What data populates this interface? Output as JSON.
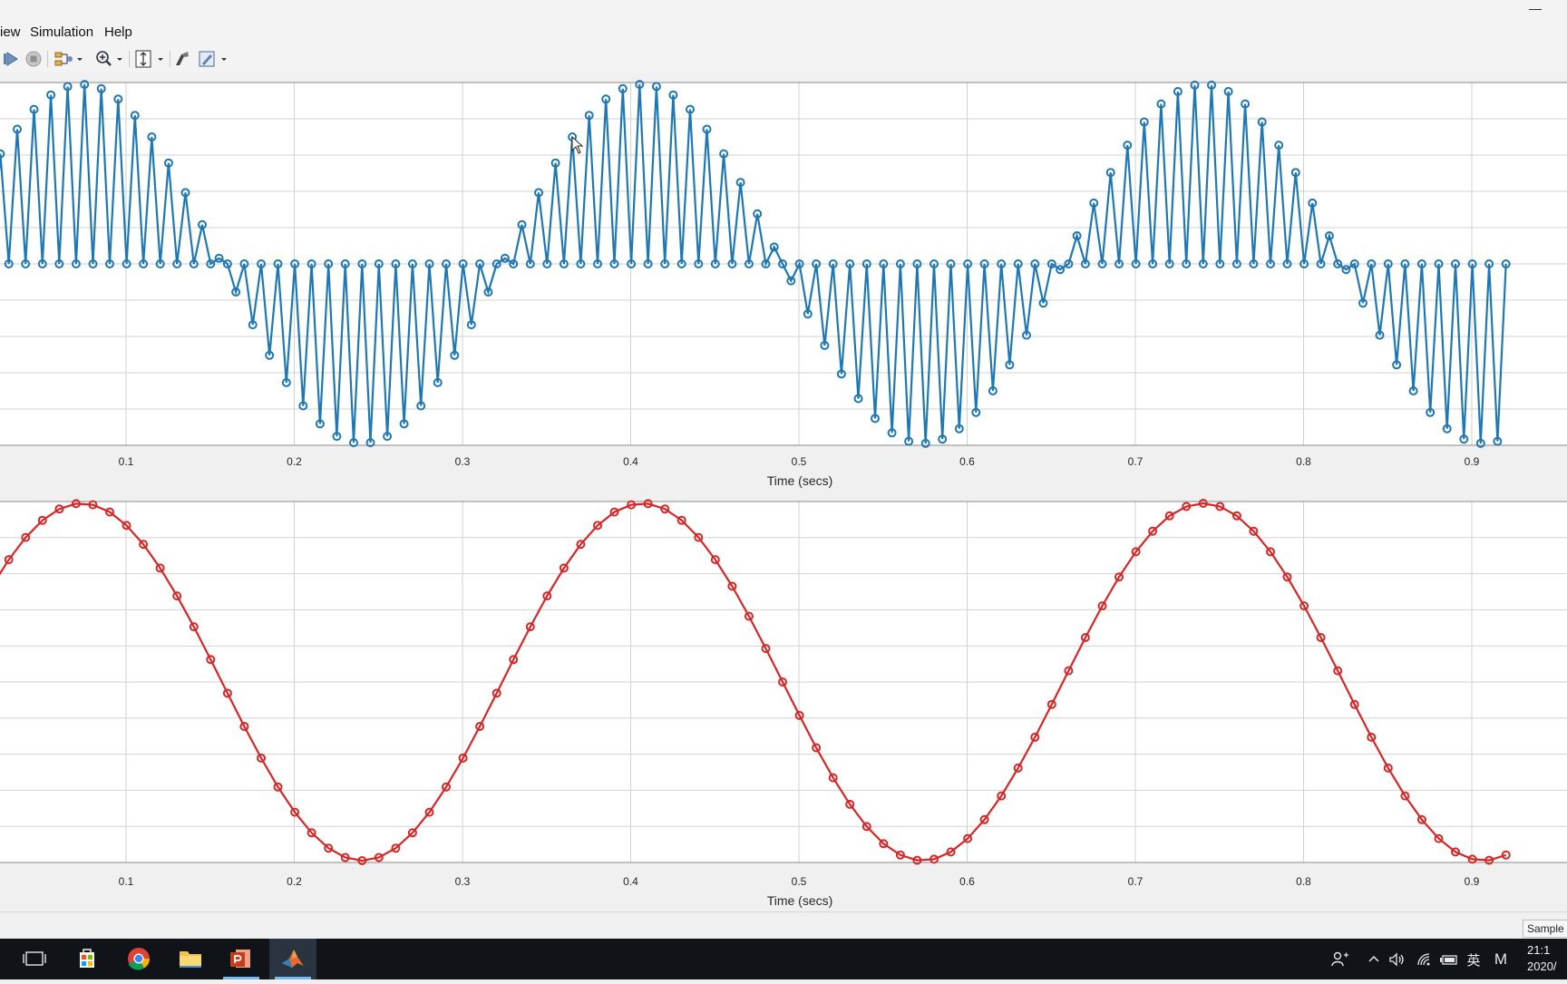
{
  "window": {
    "minimize_glyph": "—"
  },
  "menu": {
    "items": [
      "iew",
      "Simulation",
      "Help"
    ]
  },
  "toolbar": {
    "icons": [
      "run-icon",
      "stop-icon",
      "signal-selector-icon",
      "zoom-icon",
      "scale-axes-icon",
      "style-icon",
      "properties-icon"
    ]
  },
  "colors": {
    "top_series": "#1f77b4",
    "bottom_series": "#d62728",
    "axes_bg": "#ffffff",
    "grid": "#d2d2d2"
  },
  "plots": [
    {
      "id": "top",
      "xlabel": "Time (secs)",
      "xticks": [
        "0.1",
        "0.2",
        "0.3",
        "0.4",
        "0.5",
        "0.6",
        "0.7",
        "0.8",
        "0.9"
      ],
      "grid": true
    },
    {
      "id": "bottom",
      "xlabel": "Time (secs)",
      "xticks": [
        "0.1",
        "0.2",
        "0.3",
        "0.4",
        "0.5",
        "0.6",
        "0.7",
        "0.8",
        "0.9"
      ],
      "grid": true
    }
  ],
  "chart_data": [
    {
      "type": "line",
      "series": [
        {
          "signal": "sampled_carrier",
          "color": "#1f77b4",
          "marker": "circle",
          "description": "sin(2*pi*3*t) multiplied by alternating impulse train, sampled every 0.005 s"
        }
      ],
      "x_range": [
        0.0,
        0.93
      ],
      "y_range": [
        -1,
        1
      ],
      "xlabel": "Time (secs)",
      "xticks": [
        0.1,
        0.2,
        0.3,
        0.4,
        0.5,
        0.6,
        0.7,
        0.8,
        0.9
      ],
      "signal_frequency_hz": 3,
      "sample_period": 0.005,
      "grid": true
    },
    {
      "type": "line",
      "series": [
        {
          "signal": "sine",
          "color": "#d62728",
          "marker": "circle",
          "description": "sin(2*pi*3*t), sampled every 0.01 s"
        }
      ],
      "x_range": [
        0.0,
        0.93
      ],
      "y_range": [
        -1,
        1
      ],
      "xlabel": "Time (secs)",
      "xticks": [
        0.1,
        0.2,
        0.3,
        0.4,
        0.5,
        0.6,
        0.7,
        0.8,
        0.9
      ],
      "signal_frequency_hz": 3,
      "sample_period": 0.01,
      "grid": true
    }
  ],
  "status": {
    "field": "Sample"
  },
  "taskbar": {
    "apps": [
      "task-view-icon",
      "store-icon",
      "chrome-icon",
      "file-explorer-icon",
      "powerpoint-icon",
      "matlab-icon"
    ],
    "ime": "英",
    "ime2": "M",
    "clock_time": "21:1",
    "clock_date": "2020/"
  }
}
